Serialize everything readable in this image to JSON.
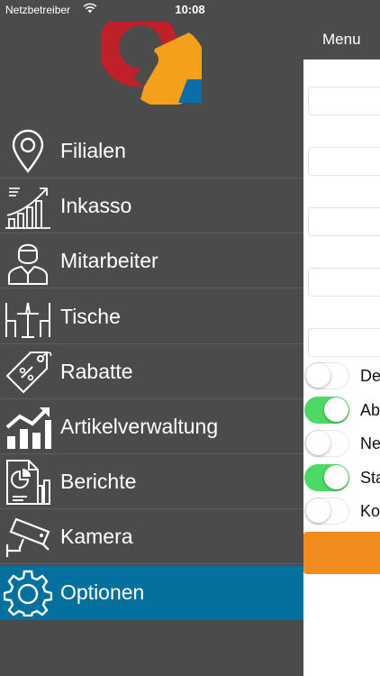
{
  "status_bar": {
    "carrier": "Netzbetreiber",
    "time": "10:08"
  },
  "header": {
    "menu_title": "Menu"
  },
  "menu": {
    "items": [
      {
        "label": "Filialen",
        "icon": "location-pin-icon"
      },
      {
        "label": "Inkasso",
        "icon": "growth-chart-icon"
      },
      {
        "label": "Mitarbeiter",
        "icon": "employee-icon"
      },
      {
        "label": "Tische",
        "icon": "table-chairs-icon"
      },
      {
        "label": "Rabatte",
        "icon": "discount-tag-icon"
      },
      {
        "label": "Artikelverwaltung",
        "icon": "bar-chart-icon"
      },
      {
        "label": "Berichte",
        "icon": "report-icon"
      },
      {
        "label": "Kamera",
        "icon": "security-camera-icon"
      },
      {
        "label": "Optionen",
        "icon": "gear-icon",
        "active": true
      }
    ]
  },
  "settings": {
    "toggles": [
      {
        "label": "De",
        "on": false
      },
      {
        "label": "Ab",
        "on": true
      },
      {
        "label": "Ne",
        "on": false
      },
      {
        "label": "Sta",
        "on": true
      },
      {
        "label": "Ko",
        "on": false
      }
    ]
  },
  "colors": {
    "menu_background": "#4b4b4b",
    "active_item": "#03709e",
    "toggle_on": "#4cd964",
    "button_orange": "#f28c1e",
    "logo_red": "#c0202a",
    "logo_orange": "#f5a01a",
    "logo_blue": "#0a6fa8"
  }
}
